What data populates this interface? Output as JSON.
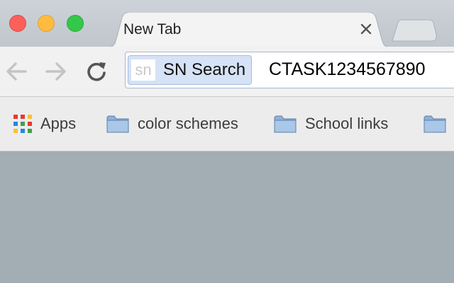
{
  "window": {
    "controls": [
      "close",
      "minimize",
      "maximize"
    ],
    "colors": {
      "close": "#fc605b",
      "minimize": "#fdbc40",
      "maximize": "#34c84a"
    }
  },
  "tab": {
    "title": "New Tab",
    "close_icon": "close-icon"
  },
  "toolbar": {
    "back_icon": "back-arrow-icon",
    "forward_icon": "forward-arrow-icon",
    "reload_icon": "reload-icon"
  },
  "omnibox": {
    "search_engine_icon_text": "sn",
    "search_engine_label": "SN Search",
    "query": "CTASK1234567890",
    "chip_color": "#d6e2f5"
  },
  "bookmarks": {
    "items": [
      {
        "label": "Apps",
        "icon": "apps-grid-icon"
      },
      {
        "label": "color schemes",
        "icon": "folder-icon"
      },
      {
        "label": "School links",
        "icon": "folder-icon"
      },
      {
        "label": "",
        "icon": "folder-icon"
      }
    ]
  },
  "colors": {
    "page_background": "#a2adb4",
    "toolbar": "#f1f1f1",
    "bookmarks_bar": "#ececec"
  }
}
